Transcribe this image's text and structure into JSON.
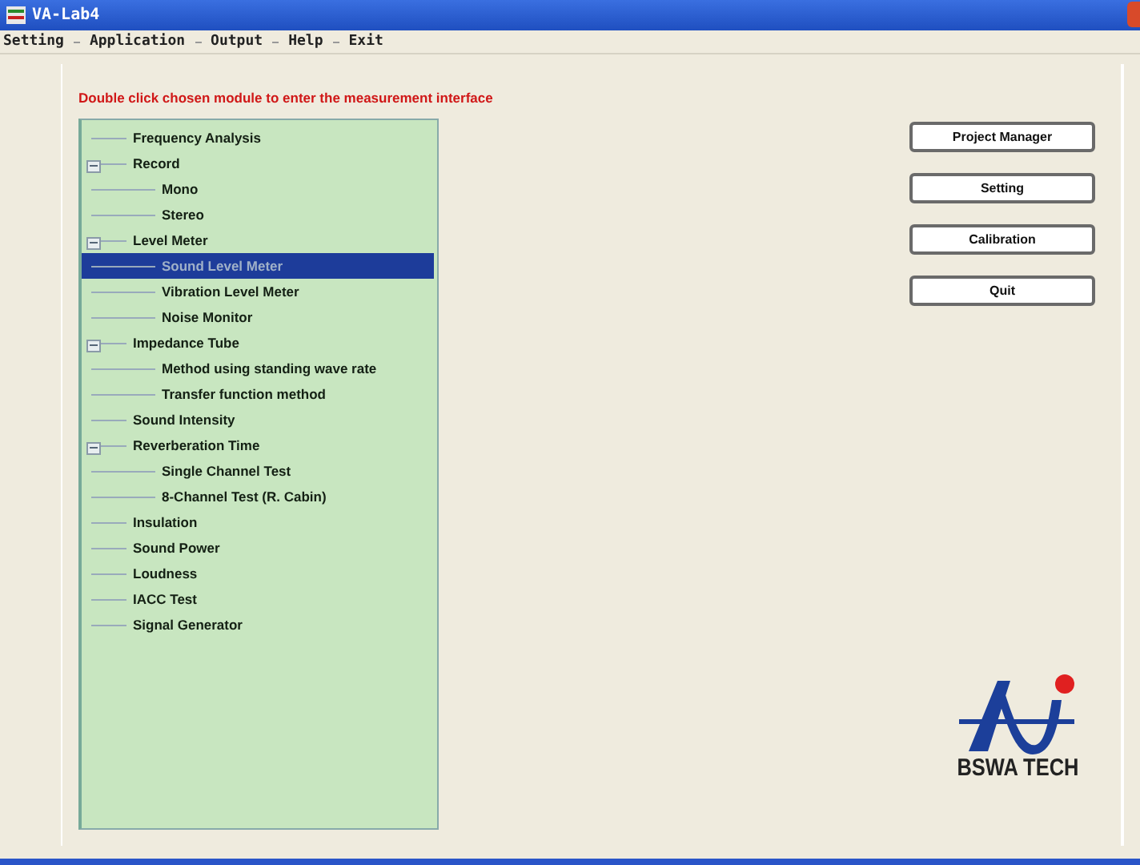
{
  "window": {
    "title": "VA-Lab4"
  },
  "menu": [
    "Setting",
    "Application",
    "Output",
    "Help",
    "Exit"
  ],
  "instruction": "Double click chosen module to enter the measurement interface",
  "tree": [
    {
      "label": "Frequency Analysis",
      "selected": false
    },
    {
      "label": "Record",
      "selected": false,
      "expanded": true,
      "children": [
        {
          "label": "Mono",
          "selected": false
        },
        {
          "label": "Stereo",
          "selected": false
        }
      ]
    },
    {
      "label": "Level Meter",
      "selected": false,
      "expanded": true,
      "children": [
        {
          "label": "Sound Level Meter",
          "selected": true
        },
        {
          "label": "Vibration Level Meter",
          "selected": false
        },
        {
          "label": "Noise Monitor",
          "selected": false
        }
      ]
    },
    {
      "label": "Impedance Tube",
      "selected": false,
      "expanded": true,
      "children": [
        {
          "label": "Method using standing wave rate",
          "selected": false
        },
        {
          "label": "Transfer function method",
          "selected": false
        }
      ]
    },
    {
      "label": "Sound Intensity",
      "selected": false
    },
    {
      "label": "Reverberation Time",
      "selected": false,
      "expanded": true,
      "children": [
        {
          "label": "Single Channel Test",
          "selected": false
        },
        {
          "label": "8-Channel Test (R. Cabin)",
          "selected": false
        }
      ]
    },
    {
      "label": "Insulation",
      "selected": false
    },
    {
      "label": "Sound Power",
      "selected": false
    },
    {
      "label": "Loudness",
      "selected": false
    },
    {
      "label": "IACC Test",
      "selected": false
    },
    {
      "label": "Signal Generator",
      "selected": false
    }
  ],
  "buttons": [
    "Project Manager",
    "Setting",
    "Calibration",
    "Quit"
  ],
  "logo": {
    "text": "BSWA TECH"
  }
}
